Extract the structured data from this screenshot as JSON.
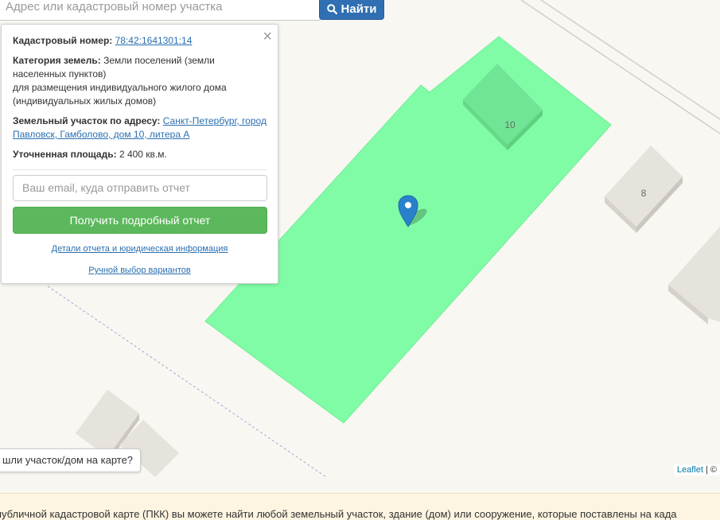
{
  "search": {
    "placeholder": "Адрес или кадастровый номер участка",
    "button_label": "Найти",
    "button_icon": "search-icon"
  },
  "popup": {
    "cadastral_label": "Кадастровый номер:",
    "cadastral_number": "78:42:1641301:14",
    "category_label": "Категория земель:",
    "category_value_1": "Земли поселений (земли",
    "category_value_2": "населенных пунктов)",
    "category_value_3": "для размещения индивидуального жилого дома",
    "category_value_4": "(индивидуальных жилых домов)",
    "address_label": "Земельный участок по адресу:",
    "address_value_1": "Санкт-Петербург, город",
    "address_value_2": "Павловск, Гамболово, дом 10, литера А",
    "area_label": "Уточненная площадь:",
    "area_value": "2 400 кв.м.",
    "email_placeholder": "Ваш email, куда отправить отчет",
    "report_button": "Получить подробный отчет",
    "details_link": "Детали отчета и юридическая информация",
    "manual_link": "Ручной выбор вариантов",
    "close_symbol": "×"
  },
  "map": {
    "house_10": "10",
    "house_8": "8",
    "plot_color": "#80fca6",
    "building_color": "#e3dfd8"
  },
  "found_question": "шли участок/дом на карте?",
  "attribution": {
    "leaflet": "Leaflet",
    "rest": " | ©"
  },
  "footer_text": "публичной кадастровой карте (ПКК) вы можете найти любой земельный участок, здание (дом) или сооружение, которые поставлены на када"
}
